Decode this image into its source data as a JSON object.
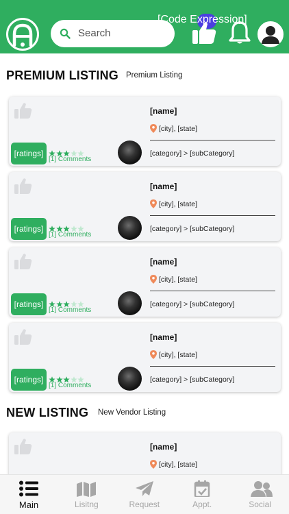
{
  "header": {
    "search_placeholder": "Search",
    "overlay_text": "[Code Expression]",
    "brand_color": "#2fae5f"
  },
  "premium": {
    "title": "PREMIUM LISTING",
    "subtitle": "Premium Listing",
    "cards": [
      {
        "name": "[name]",
        "location": "[city], [state]",
        "category": "[category] > [subCategory]",
        "ratings": "[ratings]",
        "comments": "[1] Comments",
        "stars": 3,
        "stars_max": 5
      },
      {
        "name": "[name]",
        "location": "[city], [state]",
        "category": "[category] > [subCategory]",
        "ratings": "[ratings]",
        "comments": "[1] Comments",
        "stars": 3,
        "stars_max": 5
      },
      {
        "name": "[name]",
        "location": "[city], [state]",
        "category": "[category] > [subCategory]",
        "ratings": "[ratings]",
        "comments": "[1] Comments",
        "stars": 3,
        "stars_max": 5
      },
      {
        "name": "[name]",
        "location": "[city], [state]",
        "category": "[category] > [subCategory]",
        "ratings": "[ratings]",
        "comments": "[1] Comments",
        "stars": 3,
        "stars_max": 5
      }
    ]
  },
  "new_listing": {
    "title": "NEW LISTING",
    "subtitle": "New Vendor Listing",
    "cards": [
      {
        "name": "[name]",
        "location": "[city], [state]"
      }
    ]
  },
  "bottom_nav": [
    {
      "label": "Main",
      "icon": "list-icon",
      "active": true
    },
    {
      "label": "Lisitng",
      "icon": "map-icon",
      "active": false
    },
    {
      "label": "Request",
      "icon": "paper-plane-icon",
      "active": false
    },
    {
      "label": "Appt.",
      "icon": "calendar-check-icon",
      "active": false
    },
    {
      "label": "Social",
      "icon": "users-icon",
      "active": false
    }
  ]
}
